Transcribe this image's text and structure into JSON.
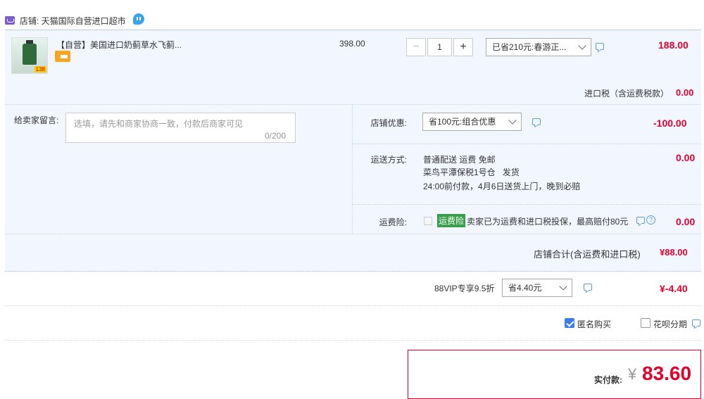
{
  "shop": {
    "label": "店铺: 天猫国际自营进口超市"
  },
  "item": {
    "title": "【自营】美国进口奶蓟草水飞蓟...",
    "image_tag": "138",
    "price": "398.00",
    "quantity": "1",
    "discount_select": "已省210元:春游正...",
    "amount": "188.00"
  },
  "tax": {
    "label": "进口税（含运费税款）",
    "amount": "0.00"
  },
  "memo": {
    "label": "给卖家留言:",
    "placeholder": "选填，请先和商家协商一致，付款后商家可见",
    "count": "0/200"
  },
  "shop_discount": {
    "label": "店铺优惠:",
    "select": "省100元:组合优惠",
    "amount": "-100.00"
  },
  "shipping": {
    "label": "运送方式:",
    "line1": "普通配送 运费 免邮",
    "line2_bold": "菜鸟平潭保税1号仓",
    "line2_rest": "发货",
    "line3": "24:00前付款，4月6日送货上门，晚到必赔",
    "amount": "0.00"
  },
  "insurance": {
    "label": "运费险:",
    "badge": "运费险",
    "text": "卖家已为运费和进口税投保，最高赔付80元",
    "amount": "0.00"
  },
  "subtotal": {
    "label": "店铺合计(含运费和进口税)",
    "amount": "¥88.00"
  },
  "vip": {
    "label": "88VIP专享9.5折",
    "select": "省4.40元",
    "amount": "¥-4.40"
  },
  "options": {
    "anonymous": "匿名购买",
    "huabei": "花呗分期"
  },
  "payment": {
    "label": "实付款:",
    "currency": "¥",
    "amount": "83.60"
  },
  "colors": {
    "accent_red": "#e4002b",
    "panel_bg": "#f2f7ff",
    "checkbox_blue": "#3b7ee8",
    "insure_green": "#3a9f4a"
  }
}
